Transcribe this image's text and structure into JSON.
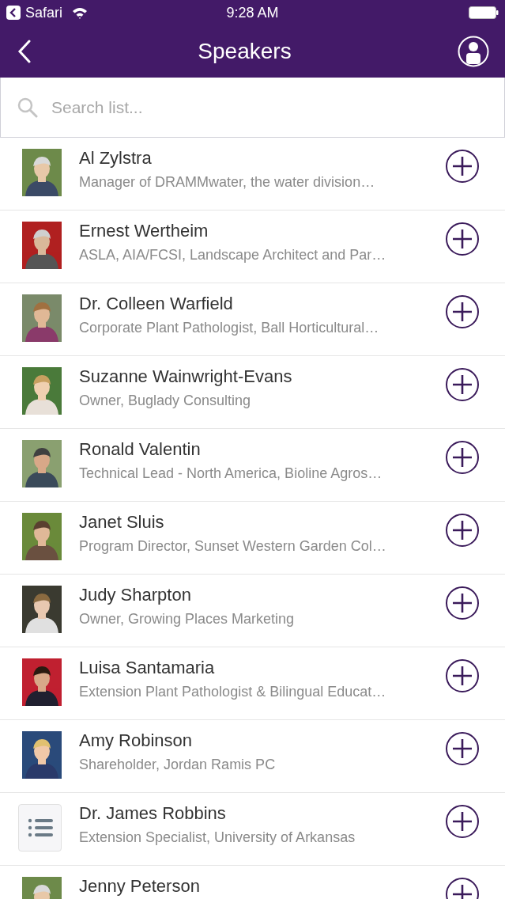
{
  "status_bar": {
    "back_app": "Safari",
    "time": "9:28 AM"
  },
  "nav_bar": {
    "title": "Speakers"
  },
  "search": {
    "placeholder": "Search list..."
  },
  "speakers": [
    {
      "name": "Al Zylstra",
      "title": "Manager of DRAMMwater, the water division…"
    },
    {
      "name": "Ernest Wertheim",
      "title": "ASLA, AIA/FCSI, Landscape Architect and Par…"
    },
    {
      "name": "Dr. Colleen Warfield",
      "title": "Corporate Plant Pathologist, Ball Horticultural…"
    },
    {
      "name": "Suzanne Wainwright-Evans",
      "title": "Owner, Buglady Consulting"
    },
    {
      "name": "Ronald Valentin",
      "title": "Technical Lead - North America, Bioline Agros…"
    },
    {
      "name": "Janet Sluis",
      "title": "Program Director, Sunset Western Garden Col…"
    },
    {
      "name": "Judy Sharpton",
      "title": "Owner, Growing Places Marketing"
    },
    {
      "name": "Luisa Santamaria",
      "title": "Extension Plant Pathologist & Bilingual Educat…"
    },
    {
      "name": "Amy Robinson",
      "title": "Shareholder, Jordan Ramis PC"
    },
    {
      "name": "Dr. James Robbins",
      "title": "Extension Specialist, University of Arkansas",
      "kind": "placeholder"
    },
    {
      "name": "Jenny Peterson"
    }
  ]
}
